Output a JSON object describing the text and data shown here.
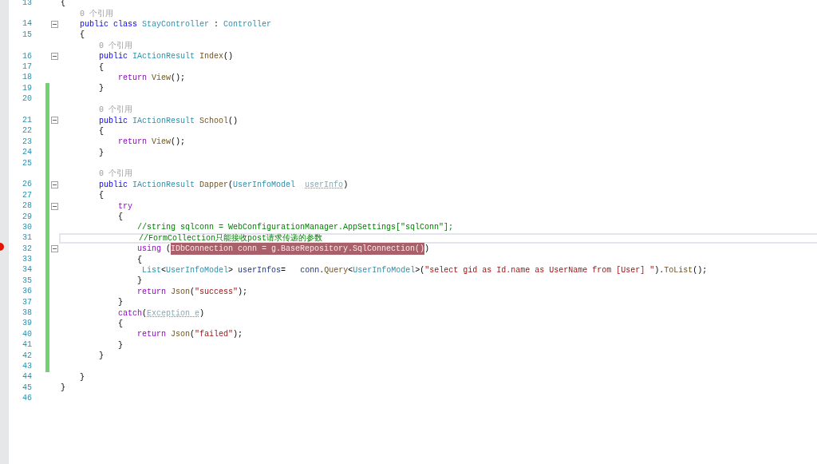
{
  "editor": {
    "rows": [
      {
        "kind": "code",
        "number": "13",
        "fold": false,
        "changed": false,
        "breakpoint": false,
        "current": false,
        "tokens": [
          {
            "kind": "plain",
            "text": "{"
          }
        ]
      },
      {
        "kind": "lens",
        "changed": false,
        "text": "    0 个引用"
      },
      {
        "kind": "code",
        "number": "14",
        "fold": true,
        "changed": false,
        "breakpoint": false,
        "current": false,
        "tokens": [
          {
            "kind": "kw",
            "text": "    public class "
          },
          {
            "kind": "type",
            "text": "StayController"
          },
          {
            "kind": "plain",
            "text": " : "
          },
          {
            "kind": "type",
            "text": "Controller"
          }
        ]
      },
      {
        "kind": "code",
        "number": "15",
        "fold": false,
        "changed": false,
        "breakpoint": false,
        "current": false,
        "tokens": [
          {
            "kind": "plain",
            "text": "    {"
          }
        ]
      },
      {
        "kind": "lens",
        "changed": false,
        "text": "        0 个引用"
      },
      {
        "kind": "code",
        "number": "16",
        "fold": true,
        "changed": false,
        "breakpoint": false,
        "current": false,
        "tokens": [
          {
            "kind": "kw",
            "text": "        public "
          },
          {
            "kind": "type",
            "text": "IActionResult "
          },
          {
            "kind": "method",
            "text": "Index"
          },
          {
            "kind": "plain",
            "text": "()"
          }
        ]
      },
      {
        "kind": "code",
        "number": "17",
        "fold": false,
        "changed": false,
        "breakpoint": false,
        "current": false,
        "tokens": [
          {
            "kind": "plain",
            "text": "        {"
          }
        ]
      },
      {
        "kind": "code",
        "number": "18",
        "fold": false,
        "changed": false,
        "breakpoint": false,
        "current": false,
        "tokens": [
          {
            "kind": "ctrl",
            "text": "            return "
          },
          {
            "kind": "method",
            "text": "View"
          },
          {
            "kind": "plain",
            "text": "();"
          }
        ]
      },
      {
        "kind": "code",
        "number": "19",
        "fold": false,
        "changed": true,
        "breakpoint": false,
        "current": false,
        "tokens": [
          {
            "kind": "plain",
            "text": "        }"
          }
        ]
      },
      {
        "kind": "code",
        "number": "20",
        "fold": false,
        "changed": true,
        "breakpoint": false,
        "current": false
      },
      {
        "kind": "lens",
        "changed": true,
        "text": "        0 个引用"
      },
      {
        "kind": "code",
        "number": "21",
        "fold": true,
        "changed": true,
        "breakpoint": false,
        "current": false,
        "tokens": [
          {
            "kind": "kw",
            "text": "        public "
          },
          {
            "kind": "type",
            "text": "IActionResult "
          },
          {
            "kind": "method",
            "text": "School"
          },
          {
            "kind": "plain",
            "text": "()"
          }
        ]
      },
      {
        "kind": "code",
        "number": "22",
        "fold": false,
        "changed": true,
        "breakpoint": false,
        "current": false,
        "tokens": [
          {
            "kind": "plain",
            "text": "        {"
          }
        ]
      },
      {
        "kind": "code",
        "number": "23",
        "fold": false,
        "changed": true,
        "breakpoint": false,
        "current": false,
        "tokens": [
          {
            "kind": "ctrl",
            "text": "            return "
          },
          {
            "kind": "method",
            "text": "View"
          },
          {
            "kind": "plain",
            "text": "();"
          }
        ]
      },
      {
        "kind": "code",
        "number": "24",
        "fold": false,
        "changed": true,
        "breakpoint": false,
        "current": false,
        "tokens": [
          {
            "kind": "plain",
            "text": "        }"
          }
        ]
      },
      {
        "kind": "code",
        "number": "25",
        "fold": false,
        "changed": true,
        "breakpoint": false,
        "current": false
      },
      {
        "kind": "lens",
        "changed": true,
        "text": "        0 个引用"
      },
      {
        "kind": "code",
        "number": "26",
        "fold": true,
        "changed": true,
        "breakpoint": false,
        "current": false,
        "tokens": [
          {
            "kind": "kw",
            "text": "        public "
          },
          {
            "kind": "type",
            "text": "IActionResult "
          },
          {
            "kind": "method",
            "text": "Dapper"
          },
          {
            "kind": "plain",
            "text": "("
          },
          {
            "kind": "type",
            "text": "UserInfoModel"
          },
          {
            "kind": "unused",
            "text": "  userInfo"
          },
          {
            "kind": "plain",
            "text": ")"
          }
        ]
      },
      {
        "kind": "code",
        "number": "27",
        "fold": false,
        "changed": true,
        "breakpoint": false,
        "current": false,
        "tokens": [
          {
            "kind": "plain",
            "text": "        {"
          }
        ]
      },
      {
        "kind": "code",
        "number": "28",
        "fold": true,
        "changed": true,
        "breakpoint": false,
        "current": false,
        "tokens": [
          {
            "kind": "ctrl",
            "text": "            try"
          }
        ]
      },
      {
        "kind": "code",
        "number": "29",
        "fold": false,
        "changed": true,
        "breakpoint": false,
        "current": false,
        "tokens": [
          {
            "kind": "plain",
            "text": "            {"
          }
        ]
      },
      {
        "kind": "code",
        "number": "30",
        "fold": false,
        "changed": true,
        "breakpoint": false,
        "current": false,
        "tokens": [
          {
            "kind": "comment",
            "text": "                //string sqlconn = WebConfigurationManager.AppSettings[\"sqlConn\"];"
          }
        ]
      },
      {
        "kind": "code",
        "number": "31",
        "fold": false,
        "changed": true,
        "breakpoint": false,
        "current": true,
        "tokens": [
          {
            "kind": "comment",
            "text": "                //FormCollection只能接收post请求传递的参数"
          }
        ]
      },
      {
        "kind": "code",
        "number": "32",
        "fold": true,
        "changed": true,
        "breakpoint": true,
        "current": false,
        "tokens": [
          {
            "kind": "ctrl",
            "text": "                using "
          },
          {
            "kind": "plain",
            "text": "("
          },
          {
            "kind": "highlight",
            "text": "IDbConnection conn = g.BaseRepository.SqlConnection()"
          },
          {
            "kind": "plain",
            "text": ")"
          }
        ]
      },
      {
        "kind": "code",
        "number": "33",
        "fold": false,
        "changed": true,
        "breakpoint": false,
        "current": false,
        "tokens": [
          {
            "kind": "plain",
            "text": "                {"
          }
        ]
      },
      {
        "kind": "code",
        "number": "34",
        "fold": false,
        "changed": true,
        "breakpoint": false,
        "current": false,
        "tokens": [
          {
            "kind": "type",
            "text": "                 List"
          },
          {
            "kind": "plain",
            "text": "<"
          },
          {
            "kind": "type",
            "text": "UserInfoModel"
          },
          {
            "kind": "plain",
            "text": "> "
          },
          {
            "kind": "param",
            "text": "userInfos"
          },
          {
            "kind": "plain",
            "text": "=   "
          },
          {
            "kind": "param",
            "text": "conn"
          },
          {
            "kind": "plain",
            "text": "."
          },
          {
            "kind": "method",
            "text": "Query"
          },
          {
            "kind": "plain",
            "text": "<"
          },
          {
            "kind": "type",
            "text": "UserInfoModel"
          },
          {
            "kind": "plain",
            "text": ">("
          },
          {
            "kind": "string",
            "text": "\"select gid as Id.name as UserName from [User] \""
          },
          {
            "kind": "plain",
            "text": ")."
          },
          {
            "kind": "method",
            "text": "ToList"
          },
          {
            "kind": "plain",
            "text": "();"
          }
        ]
      },
      {
        "kind": "code",
        "number": "35",
        "fold": false,
        "changed": true,
        "breakpoint": false,
        "current": false,
        "tokens": [
          {
            "kind": "plain",
            "text": "                }"
          }
        ]
      },
      {
        "kind": "code",
        "number": "36",
        "fold": false,
        "changed": true,
        "breakpoint": false,
        "current": false,
        "tokens": [
          {
            "kind": "ctrl",
            "text": "                return "
          },
          {
            "kind": "method",
            "text": "Json"
          },
          {
            "kind": "plain",
            "text": "("
          },
          {
            "kind": "string",
            "text": "\"success\""
          },
          {
            "kind": "plain",
            "text": ");"
          }
        ]
      },
      {
        "kind": "code",
        "number": "37",
        "fold": false,
        "changed": true,
        "breakpoint": false,
        "current": false,
        "tokens": [
          {
            "kind": "plain",
            "text": "            }"
          }
        ]
      },
      {
        "kind": "code",
        "number": "38",
        "fold": false,
        "changed": true,
        "breakpoint": false,
        "current": false,
        "tokens": [
          {
            "kind": "ctrl",
            "text": "            catch"
          },
          {
            "kind": "plain",
            "text": "("
          },
          {
            "kind": "unused",
            "text": "Exception e"
          },
          {
            "kind": "plain",
            "text": ")"
          }
        ]
      },
      {
        "kind": "code",
        "number": "39",
        "fold": false,
        "changed": true,
        "breakpoint": false,
        "current": false,
        "tokens": [
          {
            "kind": "plain",
            "text": "            {"
          }
        ]
      },
      {
        "kind": "code",
        "number": "40",
        "fold": false,
        "changed": true,
        "breakpoint": false,
        "current": false,
        "tokens": [
          {
            "kind": "ctrl",
            "text": "                return "
          },
          {
            "kind": "method",
            "text": "Json"
          },
          {
            "kind": "plain",
            "text": "("
          },
          {
            "kind": "string",
            "text": "\"failed\""
          },
          {
            "kind": "plain",
            "text": ");"
          }
        ]
      },
      {
        "kind": "code",
        "number": "41",
        "fold": false,
        "changed": true,
        "breakpoint": false,
        "current": false,
        "tokens": [
          {
            "kind": "plain",
            "text": "            }"
          }
        ]
      },
      {
        "kind": "code",
        "number": "42",
        "fold": false,
        "changed": true,
        "breakpoint": false,
        "current": false,
        "tokens": [
          {
            "kind": "plain",
            "text": "        }"
          }
        ]
      },
      {
        "kind": "code",
        "number": "43",
        "fold": false,
        "changed": true,
        "breakpoint": false,
        "current": false
      },
      {
        "kind": "code",
        "number": "44",
        "fold": false,
        "changed": false,
        "breakpoint": false,
        "current": false,
        "tokens": [
          {
            "kind": "plain",
            "text": "    }"
          }
        ]
      },
      {
        "kind": "code",
        "number": "45",
        "fold": false,
        "changed": false,
        "breakpoint": false,
        "current": false,
        "tokens": [
          {
            "kind": "plain",
            "text": "}"
          }
        ]
      },
      {
        "kind": "code",
        "number": "46",
        "fold": false,
        "changed": false,
        "breakpoint": false,
        "current": false
      }
    ]
  }
}
